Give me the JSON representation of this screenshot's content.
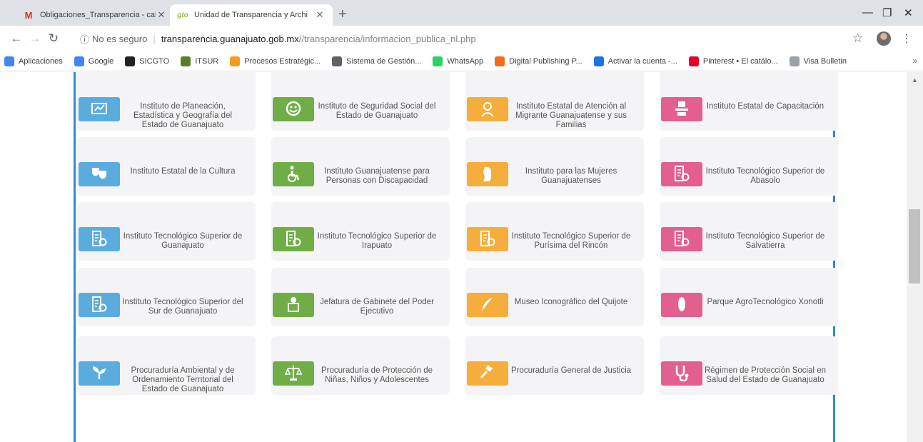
{
  "tabs": [
    {
      "title": "Obligaciones_Transparencia - cal",
      "favicon": "gmail-icon",
      "active": false
    },
    {
      "title": "Unidad de Transparencia y Archi",
      "favicon": "gto-icon",
      "active": true
    }
  ],
  "tab_favicon_text": {
    "gmail": "M",
    "gto": "gto"
  },
  "address": {
    "security_label": "No es seguro",
    "host": "transparencia.guanajuato.gob.mx",
    "path": "//transparencia/informacion_publica_nl.php"
  },
  "bookmarks": [
    {
      "label": "Aplicaciones",
      "icon": "apps-grid-icon",
      "color": "#4285f4"
    },
    {
      "label": "Google",
      "icon": "google-icon",
      "color": "#4285f4"
    },
    {
      "label": "SICGTO",
      "icon": "barcode-icon",
      "color": "#222222"
    },
    {
      "label": "ITSUR",
      "icon": "itsur-icon",
      "color": "#5a7d2c"
    },
    {
      "label": "Procesos Estratégic...",
      "icon": "folder-icon",
      "color": "#f59b1f"
    },
    {
      "label": "Sistema de Gestión...",
      "icon": "globe-icon",
      "color": "#5f6368"
    },
    {
      "label": "WhatsApp",
      "icon": "whatsapp-icon",
      "color": "#25d366"
    },
    {
      "label": "Digital Publishing P...",
      "icon": "publishing-icon",
      "color": "#f26b1d"
    },
    {
      "label": "Activar la cuenta -...",
      "icon": "chat-icon",
      "color": "#1a73e8"
    },
    {
      "label": "Pinterest • El catálo...",
      "icon": "pinterest-icon",
      "color": "#e60023"
    },
    {
      "label": "Visa Bulletin",
      "icon": "seal-icon",
      "color": "#9aa0a6"
    }
  ],
  "bookmarks_more": "»",
  "institutions": [
    {
      "name": "Instituto de Planeación, Estadística y Geografía del Estado de Guanajuato",
      "icon": "statistics-icon",
      "color": "blue"
    },
    {
      "name": "Instituto de Seguridad Social del Estado de Guanajuato",
      "icon": "social-security-icon",
      "color": "green"
    },
    {
      "name": "Instituto Estatal de Atención al Migrante Guanajuatense y sus Familias",
      "icon": "migrant-icon",
      "color": "orange"
    },
    {
      "name": "Instituto Estatal de Capacitación",
      "icon": "training-icon",
      "color": "pink"
    },
    {
      "name": "Instituto Estatal de la Cultura",
      "icon": "theater-masks-icon",
      "color": "blue"
    },
    {
      "name": "Instituto Guanajuatense para Personas con Discapacidad",
      "icon": "wheelchair-icon",
      "color": "green"
    },
    {
      "name": "Instituto para las Mujeres Guanajuatenses",
      "icon": "woman-profile-icon",
      "color": "orange"
    },
    {
      "name": "Instituto Tecnológico Superior de Abasolo",
      "icon": "tech-institute-icon",
      "color": "pink"
    },
    {
      "name": "Instituto Tecnológico Superior de Guanajuato",
      "icon": "tech-institute-icon",
      "color": "blue"
    },
    {
      "name": "Instituto Tecnológico Superior de Irapuato",
      "icon": "tech-institute-icon",
      "color": "green"
    },
    {
      "name": "Instituto Tecnológico Superior de Purísima del Rincón",
      "icon": "tech-institute-icon",
      "color": "orange"
    },
    {
      "name": "Instituto Tecnológico Superior de Salvatierra",
      "icon": "tech-institute-icon",
      "color": "pink"
    },
    {
      "name": "Instituto Tecnológico Superior del Sur de Guanajuato",
      "icon": "tech-institute-icon",
      "color": "blue"
    },
    {
      "name": "Jefatura de Gabinete del Poder Ejecutivo",
      "icon": "cabinet-icon",
      "color": "green"
    },
    {
      "name": "Museo Iconográfico del Quijote",
      "icon": "quill-icon",
      "color": "orange"
    },
    {
      "name": "Parque AgroTecnológico Xonotli",
      "icon": "corn-icon",
      "color": "pink"
    },
    {
      "name": "Procuraduría Ambiental y de Ordenamiento Territorial del Estado de Guanajuato",
      "icon": "plant-icon",
      "color": "blue"
    },
    {
      "name": "Procuraduría de Protección de Niñas, Niños y Adolescentes",
      "icon": "scales-icon",
      "color": "green"
    },
    {
      "name": "Procuraduría General de Justicia",
      "icon": "gavel-icon",
      "color": "orange"
    },
    {
      "name": "Régimen de Protección Social en Salud del Estado de Guanajuato",
      "icon": "stethoscope-icon",
      "color": "pink"
    }
  ]
}
